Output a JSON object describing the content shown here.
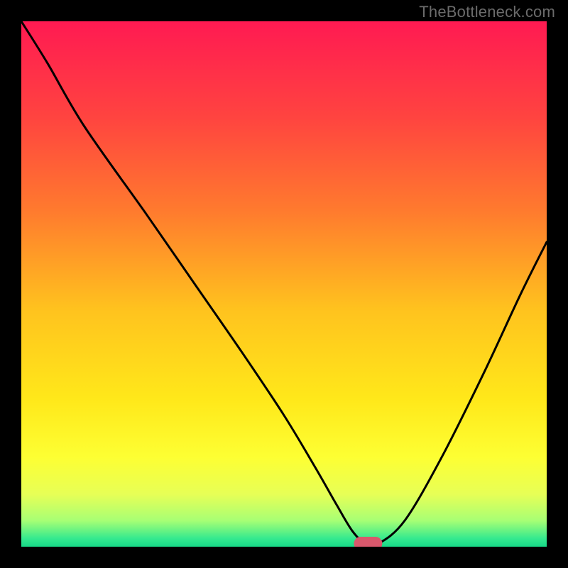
{
  "watermark": "TheBottleneck.com",
  "chart_data": {
    "type": "line",
    "title": "",
    "xlabel": "",
    "ylabel": "",
    "xlim": [
      0,
      100
    ],
    "ylim": [
      0,
      100
    ],
    "grid": false,
    "legend": false,
    "background_gradient_stops": [
      {
        "offset": 0.0,
        "color": "#ff1a52"
      },
      {
        "offset": 0.18,
        "color": "#ff4340"
      },
      {
        "offset": 0.36,
        "color": "#ff7a2e"
      },
      {
        "offset": 0.55,
        "color": "#ffc31e"
      },
      {
        "offset": 0.72,
        "color": "#ffe81a"
      },
      {
        "offset": 0.83,
        "color": "#fdff33"
      },
      {
        "offset": 0.9,
        "color": "#e7ff56"
      },
      {
        "offset": 0.95,
        "color": "#a8ff74"
      },
      {
        "offset": 0.985,
        "color": "#33e98f"
      },
      {
        "offset": 1.0,
        "color": "#17d987"
      }
    ],
    "series": [
      {
        "name": "bottleneck-curve",
        "x": [
          0,
          5,
          12,
          24,
          33,
          42,
          50,
          56,
          60,
          63,
          65.5,
          68,
          73,
          80,
          88,
          95,
          100
        ],
        "y": [
          100,
          92,
          80,
          63,
          50,
          37,
          25,
          15,
          8,
          3,
          0.6,
          0.6,
          5,
          17,
          33,
          48,
          58
        ]
      }
    ],
    "marker": {
      "name": "optimal-point",
      "x": 66,
      "y": 0.6,
      "rx": 2.7,
      "ry": 1.3,
      "color": "#d9586c"
    }
  }
}
